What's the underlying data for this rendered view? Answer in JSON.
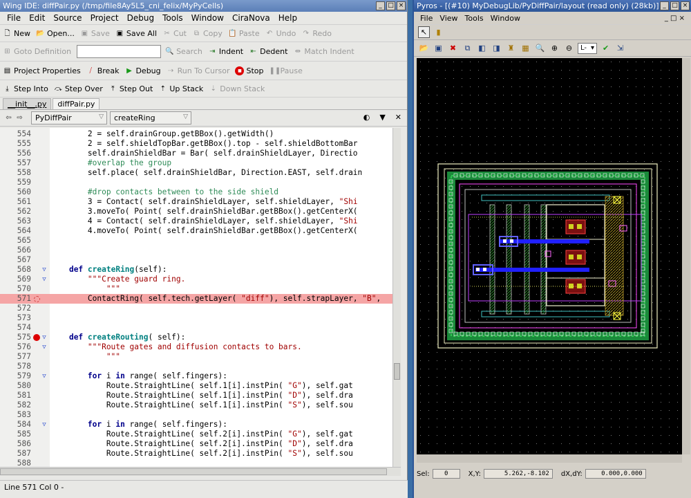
{
  "wing": {
    "title": "Wing IDE: diffPair.py (/tmp/file8Ay5L5_cni_felix/MyPyCells)",
    "menu": [
      "File",
      "Edit",
      "Source",
      "Project",
      "Debug",
      "Tools",
      "Window",
      "CiraNova",
      "Help"
    ],
    "toolbar1": [
      "New",
      "Open...",
      "Save",
      "Save All",
      "Cut",
      "Copy",
      "Paste",
      "Undo",
      "Redo"
    ],
    "toolbar2": {
      "goto": "Goto Definition",
      "search": "Search",
      "indent": "Indent",
      "dedent": "Dedent",
      "match": "Match Indent"
    },
    "toolbar3": [
      "Project Properties",
      "Break",
      "Debug",
      "Run To Cursor",
      "Stop",
      "Pause"
    ],
    "toolbar4": [
      "Step Into",
      "Step Over",
      "Step Out",
      "Up Stack",
      "Down Stack"
    ],
    "tabs": [
      "__init__.py",
      "diffPair.py"
    ],
    "nav_class": "PyDiffPair",
    "nav_method": "createRing",
    "status": "Line 571 Col 0 -"
  },
  "code_lines": [
    {
      "n": "554",
      "t": "        w2 = self.drainGroup.getBBox().getWidth()"
    },
    {
      "n": "555",
      "t": "        l2 = self.shieldTopBar.getBBox().top - self.shieldBottomBar"
    },
    {
      "n": "556",
      "t": "        self.drainShieldBar = Bar( self.drainShieldLayer, Directio"
    },
    {
      "n": "557",
      "t": "        #overlap the group"
    },
    {
      "n": "558",
      "t": "        self.place( self.drainShieldBar, Direction.EAST, self.drain"
    },
    {
      "n": "559",
      "t": ""
    },
    {
      "n": "560",
      "t": "        #drop contacts between to the side shield"
    },
    {
      "n": "561",
      "t": "        c3 = Contact( self.drainShieldLayer, self.shieldLayer, \"Shi"
    },
    {
      "n": "562",
      "t": "        c3.moveTo( Point( self.drainShieldBar.getBBox().getCenterX("
    },
    {
      "n": "563",
      "t": "        c4 = Contact( self.drainShieldLayer, self.shieldLayer, \"Shi"
    },
    {
      "n": "564",
      "t": "        c4.moveTo( Point( self.drainShieldBar.getBBox().getCenterX("
    },
    {
      "n": "565",
      "t": ""
    },
    {
      "n": "566",
      "t": ""
    },
    {
      "n": "567",
      "t": ""
    },
    {
      "n": "568",
      "t": "    def createRing(self):"
    },
    {
      "n": "569",
      "t": "        \"\"\"Create guard ring."
    },
    {
      "n": "570",
      "t": "            \"\"\""
    },
    {
      "n": "571",
      "t": "        ContactRing( self.tech.getLayer( \"diff\"), self.strapLayer, \"B\","
    },
    {
      "n": "572",
      "t": ""
    },
    {
      "n": "573",
      "t": ""
    },
    {
      "n": "574",
      "t": ""
    },
    {
      "n": "575",
      "t": "    def createRouting( self):"
    },
    {
      "n": "576",
      "t": "        \"\"\"Route gates and diffusion contacts to bars."
    },
    {
      "n": "577",
      "t": "            \"\"\""
    },
    {
      "n": "578",
      "t": ""
    },
    {
      "n": "579",
      "t": "        for i in range( self.fingers):"
    },
    {
      "n": "580",
      "t": "            Route.StraightLine( self.T1Units[i].instPin( \"G\"), self.gat"
    },
    {
      "n": "581",
      "t": "            Route.StraightLine( self.T1Units[i].instPin( \"D\"), self.dra"
    },
    {
      "n": "582",
      "t": "            Route.StraightLine( self.T1Units[i].instPin( \"S\"), self.sou"
    },
    {
      "n": "583",
      "t": ""
    },
    {
      "n": "584",
      "t": "        for i in range( self.fingers):"
    },
    {
      "n": "585",
      "t": "            Route.StraightLine( self.T2Units[i].instPin( \"G\"), self.gat"
    },
    {
      "n": "586",
      "t": "            Route.StraightLine( self.T2Units[i].instPin( \"D\"), self.dra"
    },
    {
      "n": "587",
      "t": "            Route.StraightLine( self.T2Units[i].instPin( \"S\"), self.sou"
    },
    {
      "n": "588",
      "t": ""
    }
  ],
  "pyros": {
    "title": "Pyros - [(#10) MyDebugLib/PyDiffPair/layout (read only) (28kb)]",
    "menu": [
      "File",
      "View",
      "Tools",
      "Window"
    ],
    "layer": "L-",
    "sel_label": "Sel:",
    "sel_value": "0",
    "xy_label": "X,Y:",
    "xy_value": "5.262,-8.102",
    "dxdy_label": "dX,dY:",
    "dxdy_value": "0.000,0.000"
  },
  "colors": {
    "highlight": "#f5a5a5",
    "keyword": "#00008b",
    "string": "#a00000",
    "comment": "#2e8b57",
    "breakpoint": "#dd0000"
  }
}
